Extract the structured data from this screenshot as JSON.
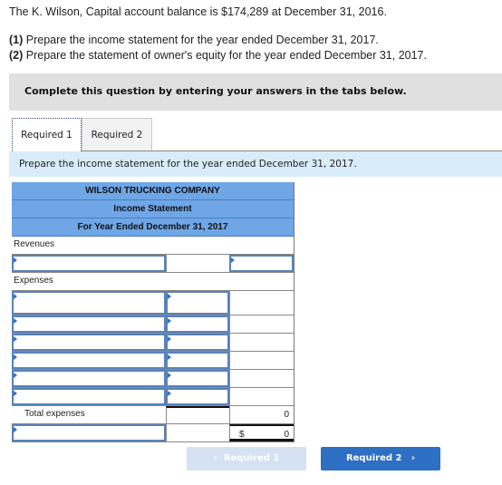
{
  "intro": {
    "line1": "The K. Wilson, Capital account balance is $174,289 at December 31, 2016.",
    "req1_num": "(1)",
    "req1_text": " Prepare the income statement for the year ended December 31, 2017.",
    "req2_num": "(2)",
    "req2_text": " Prepare the statement of owner's equity for the year ended December 31, 2017."
  },
  "instruction": "Complete this question by entering your answers in the tabs below.",
  "tabs": [
    {
      "label": "Required 1",
      "active": true
    },
    {
      "label": "Required 2",
      "active": false
    }
  ],
  "prompt": "Prepare the income statement for the year ended December 31, 2017.",
  "statement": {
    "company": "WILSON TRUCKING COMPANY",
    "title": "Income Statement",
    "period": "For Year Ended December 31, 2017",
    "revenues_label": "Revenues",
    "expenses_label": "Expenses",
    "total_expenses_label": "Total expenses",
    "total_expenses_value": "0",
    "net_currency": "$",
    "net_value": "0"
  },
  "nav": {
    "prev_label": "Required 1",
    "prev_icon": "chevron-left-icon",
    "next_label": "Required 2",
    "next_icon": "chevron-right-icon"
  },
  "colors": {
    "header_blue": "#6ea6e6",
    "prompt_bg": "#d9ecfa",
    "next_button": "#2d6fc2",
    "prev_button_disabled": "#d4e2f3"
  }
}
